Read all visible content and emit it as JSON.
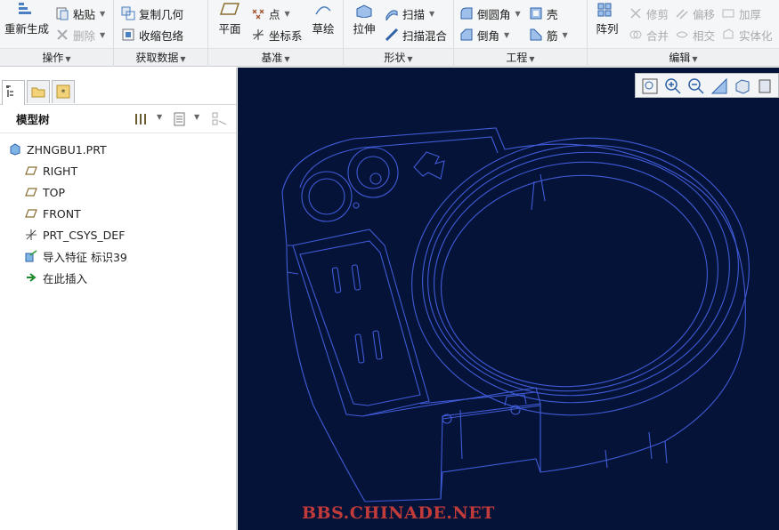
{
  "ribbon": {
    "operations": {
      "label": "操作",
      "regenerate": "重新生成",
      "paste": "粘贴",
      "delete": "删除"
    },
    "get_data": {
      "label": "获取数据",
      "copy_geometry": "复制几何",
      "shrinkwrap": "收缩包络"
    },
    "datum": {
      "label": "基准",
      "plane": "平面",
      "point": "点",
      "csys": "坐标系",
      "sketch": "草绘"
    },
    "shapes": {
      "label": "形状",
      "extrude": "拉伸",
      "sweep": "扫描",
      "swept_blend": "扫描混合"
    },
    "engineering": {
      "label": "工程",
      "round": "倒圆角",
      "chamfer": "倒角",
      "shell": "壳",
      "rib": "筋"
    },
    "editing": {
      "label": "编辑",
      "pattern": "阵列",
      "trim": "修剪",
      "offset": "偏移",
      "thicken": "加厚",
      "merge": "合并",
      "intersect": "相交",
      "solidify": "实体化"
    }
  },
  "model_tree": {
    "title": "模型树",
    "items": [
      {
        "label": "ZHNGBU1.PRT",
        "icon": "part-icon"
      },
      {
        "label": "RIGHT",
        "icon": "datum-plane-icon"
      },
      {
        "label": "TOP",
        "icon": "datum-plane-icon"
      },
      {
        "label": "FRONT",
        "icon": "datum-plane-icon"
      },
      {
        "label": "PRT_CSYS_DEF",
        "icon": "csys-icon"
      },
      {
        "label": "导入特征 标识39",
        "icon": "import-feature-icon"
      },
      {
        "label": "在此插入",
        "icon": "insert-here-arrow-icon"
      }
    ]
  },
  "viewport": {
    "watermark": "BBS.CHINADE.NET",
    "background": "#061338",
    "wire_color": "#3f5bd6"
  }
}
